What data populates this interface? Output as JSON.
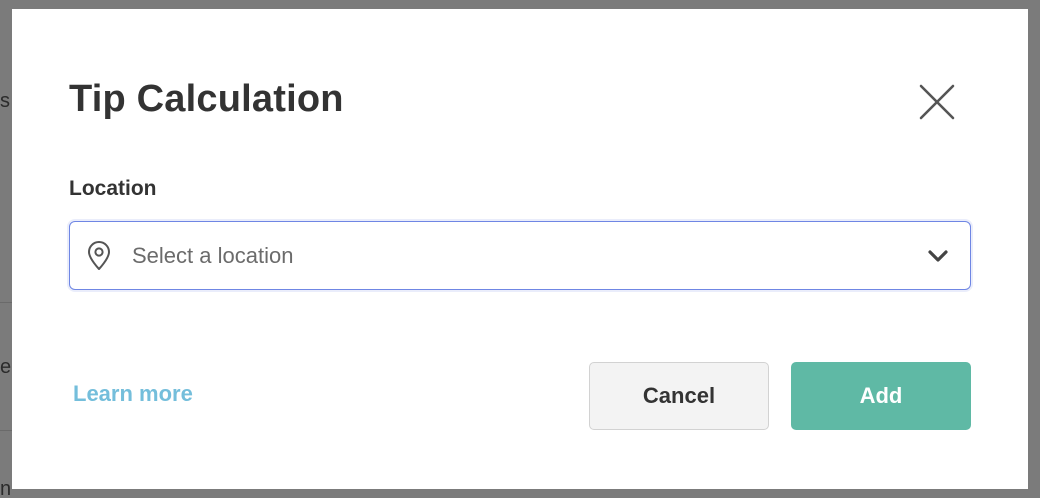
{
  "background": {
    "fragments": [
      "s",
      "e",
      "n"
    ]
  },
  "modal": {
    "title": "Tip Calculation",
    "close_icon": "close-icon",
    "location_field": {
      "label": "Location",
      "placeholder": "Select a location",
      "leading_icon": "map-pin-icon",
      "trailing_icon": "chevron-down-icon"
    },
    "footer": {
      "learn_more_label": "Learn more",
      "cancel_label": "Cancel",
      "add_label": "Add"
    }
  },
  "colors": {
    "accent_focus_border": "#6f86e4",
    "link": "#74bedb",
    "primary_button": "#5fb9a5",
    "secondary_button": "#f3f3f3",
    "title_text": "#333333",
    "overlay": "#7b7b7b"
  }
}
